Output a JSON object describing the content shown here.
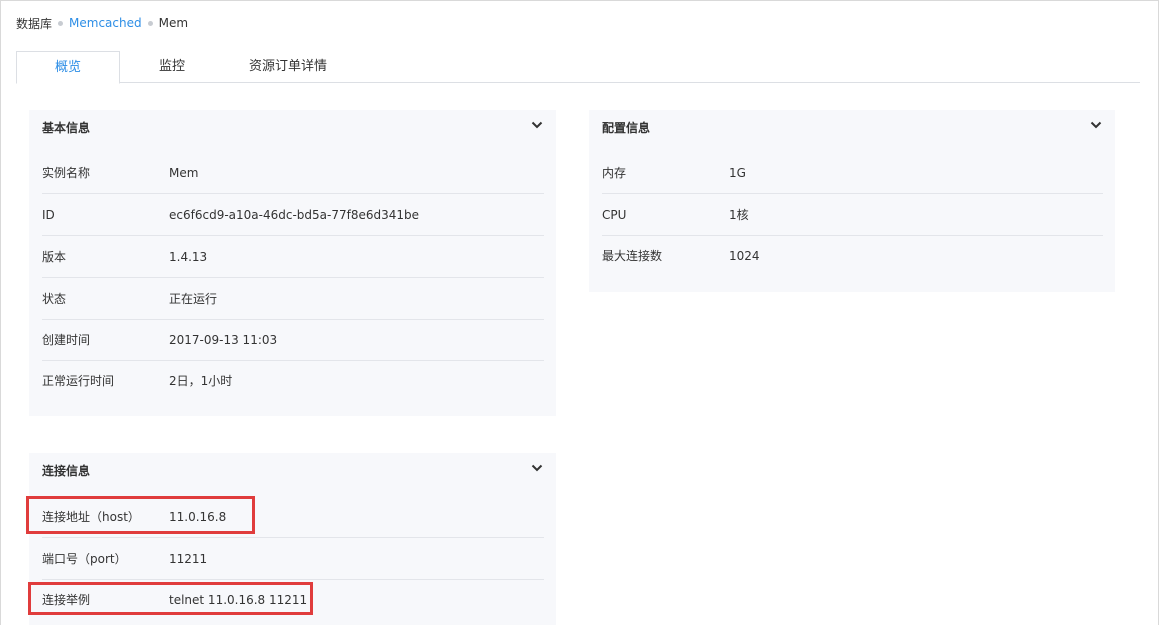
{
  "breadcrumb": {
    "root": "数据库",
    "service": "Memcached",
    "instance": "Mem"
  },
  "tabs": [
    {
      "label": "概览",
      "active": true
    },
    {
      "label": "监控",
      "active": false
    },
    {
      "label": "资源订单详情",
      "active": false
    }
  ],
  "basic_info": {
    "title": "基本信息",
    "rows": [
      {
        "label": "实例名称",
        "value": "Mem"
      },
      {
        "label": "ID",
        "value": "ec6f6cd9-a10a-46dc-bd5a-77f8e6d341be"
      },
      {
        "label": "版本",
        "value": "1.4.13"
      },
      {
        "label": "状态",
        "value": "正在运行"
      },
      {
        "label": "创建时间",
        "value": "2017-09-13 11:03"
      },
      {
        "label": "正常运行时间",
        "value": "2日，1小时"
      }
    ]
  },
  "config_info": {
    "title": "配置信息",
    "rows": [
      {
        "label": "内存",
        "value": "1G"
      },
      {
        "label": "CPU",
        "value": "1核"
      },
      {
        "label": "最大连接数",
        "value": "1024"
      }
    ]
  },
  "connection_info": {
    "title": "连接信息",
    "rows": [
      {
        "label": "连接地址（host）",
        "value": "11.0.16.8"
      },
      {
        "label": "端口号（port）",
        "value": "11211"
      },
      {
        "label": "连接举例",
        "value": "telnet 11.0.16.8 11211"
      }
    ]
  },
  "colors": {
    "link": "#2d8ee6",
    "panel_bg": "#f7f8fb",
    "highlight": "#e03c3c"
  },
  "icons": {
    "collapse": "chevron-down-icon"
  }
}
